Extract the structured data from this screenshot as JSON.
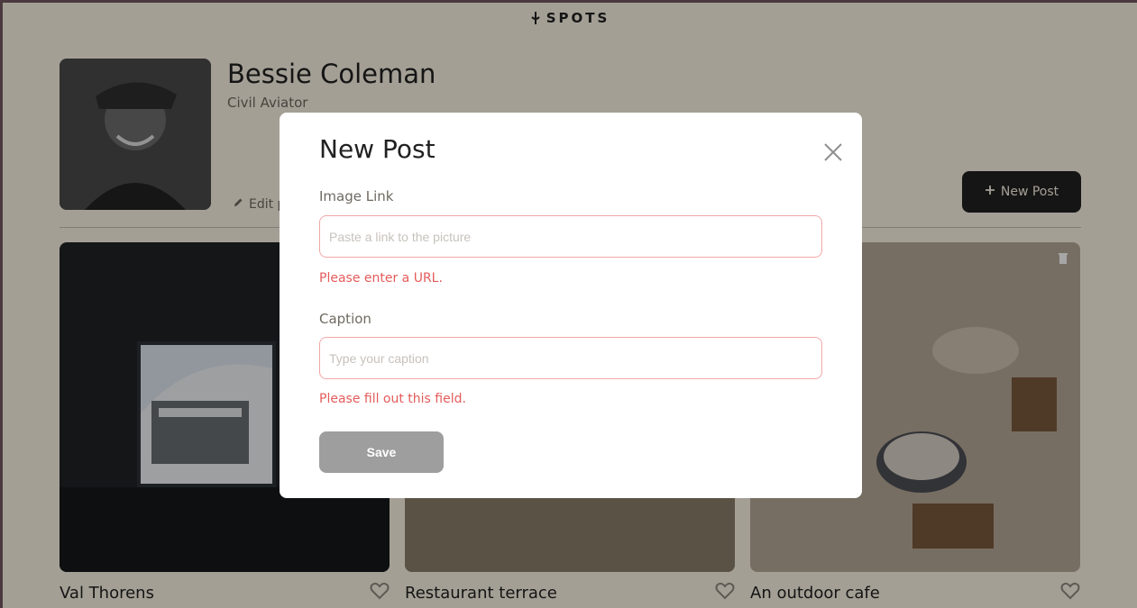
{
  "header": {
    "logo_text": "SPOTS"
  },
  "profile": {
    "name": "Bessie Coleman",
    "title": "Civil Aviator",
    "edit_label": "Edit p",
    "new_post_label": "New Post"
  },
  "cards": [
    {
      "title": "Val Thorens"
    },
    {
      "title": "Restaurant terrace"
    },
    {
      "title": "An outdoor cafe"
    }
  ],
  "modal": {
    "title": "New Post",
    "image_link_label": "Image Link",
    "image_link_placeholder": "Paste a link to the picture",
    "image_link_error": "Please enter a URL.",
    "caption_label": "Caption",
    "caption_placeholder": "Type your caption",
    "caption_error": "Please fill out this field.",
    "save_label": "Save"
  },
  "colors": {
    "page_bg": "#fcf5e5",
    "modal_bg": "#ffffff",
    "error": "#e45b5b",
    "button_disabled": "#9e9e9e",
    "dark": "#212121"
  }
}
